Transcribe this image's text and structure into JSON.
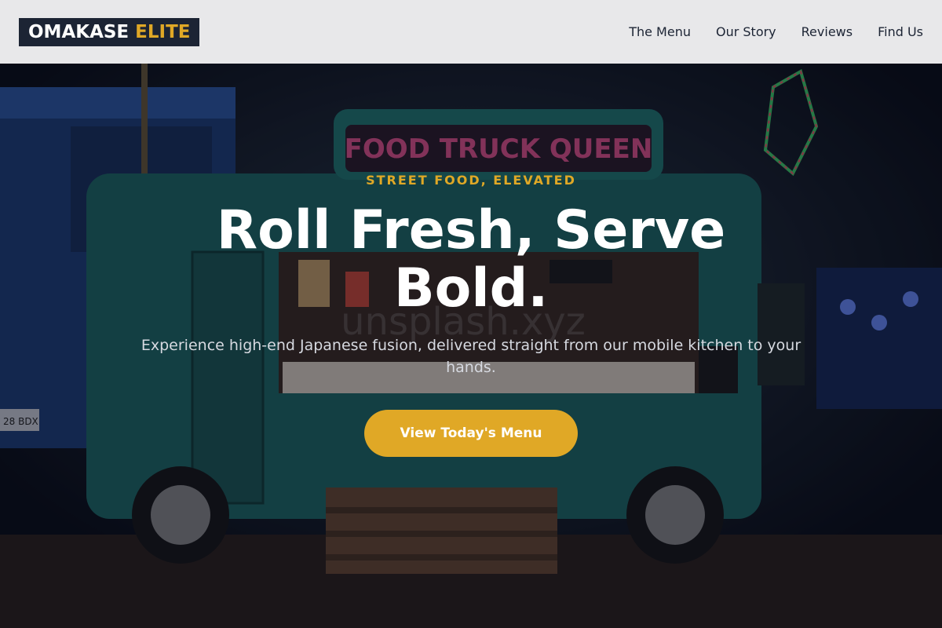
{
  "brand": {
    "name_white": "OMAKASE",
    "name_gold": "ELITE",
    "colors": {
      "dark": "#1c2434",
      "gold": "#e0a826"
    }
  },
  "nav": {
    "items": [
      {
        "label": "The Menu"
      },
      {
        "label": "Our Story"
      },
      {
        "label": "Reviews"
      },
      {
        "label": "Find Us"
      }
    ]
  },
  "hero": {
    "eyebrow": "STREET FOOD, ELEVATED",
    "headline": "Roll Fresh, Serve Bold.",
    "subtext": "Experience high-end Japanese fusion, delivered straight from our mobile kitchen to your hands.",
    "cta_label": "View Today's Menu",
    "background": {
      "truck_sign": "FOOD TRUCK QUEEN",
      "watermark": "unsplash.xyz",
      "plate": "28 BDX"
    }
  }
}
